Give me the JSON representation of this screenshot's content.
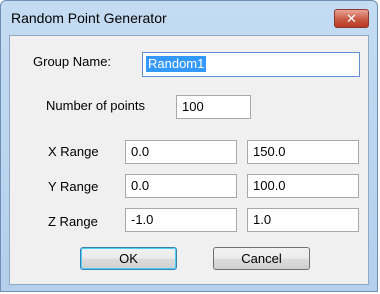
{
  "window": {
    "title": "Random Point Generator",
    "close_glyph": "✕"
  },
  "form": {
    "group_name_label": "Group Name:",
    "group_name_value": "Random1",
    "num_points_label": "Number of points",
    "num_points_value": "100",
    "x_range_label": "X Range",
    "x_min": "0.0",
    "x_max": "150.0",
    "y_range_label": "Y Range",
    "y_min": "0.0",
    "y_max": "100.0",
    "z_range_label": "Z Range",
    "z_min": "-1.0",
    "z_max": "1.0"
  },
  "buttons": {
    "ok_label": "OK",
    "cancel_label": "Cancel"
  }
}
